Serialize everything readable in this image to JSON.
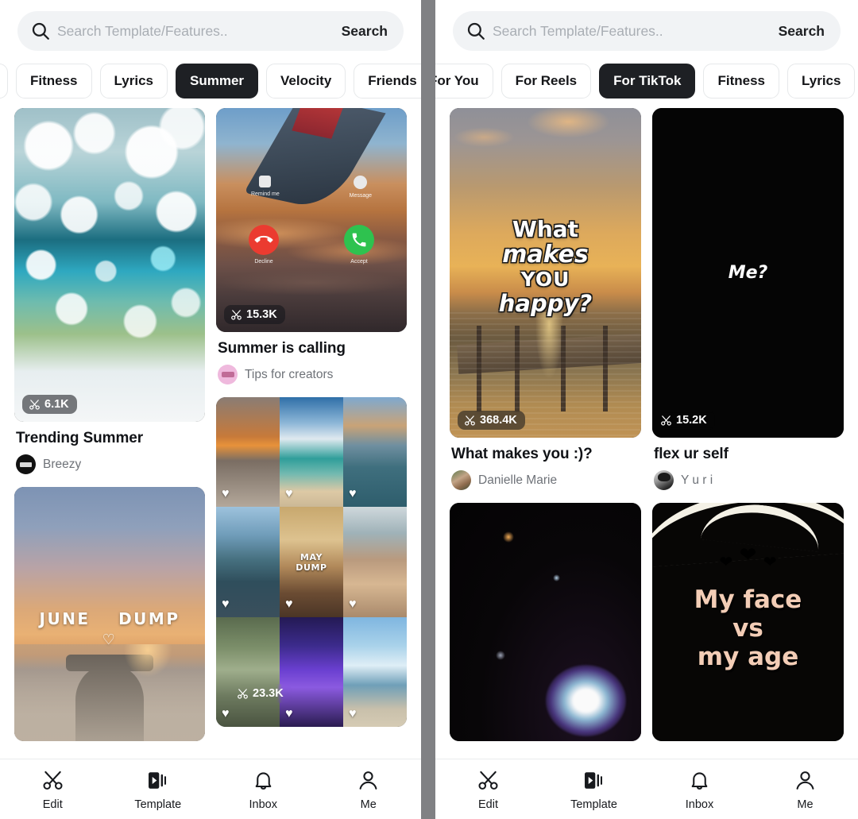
{
  "panels": [
    {
      "id": "left",
      "search": {
        "placeholder": "Search Template/Features..",
        "value": "",
        "button_label": "Search"
      },
      "chips": [
        {
          "label": "",
          "active": false,
          "clipped": true
        },
        {
          "label": "Fitness",
          "active": false
        },
        {
          "label": "Lyrics",
          "active": false
        },
        {
          "label": "Summer",
          "active": true
        },
        {
          "label": "Velocity",
          "active": false
        },
        {
          "label": "Friends",
          "active": false
        }
      ],
      "cards": {
        "col1": [
          {
            "title": "Trending Summer",
            "author": "Breezy",
            "uses": "6.1K",
            "scene": "bokeh",
            "avatar": "av-black"
          },
          {
            "title": "",
            "author": "",
            "uses": "",
            "scene": "beachsunset",
            "overlay": {
              "line1": "JUNE",
              "line2": "DUMP",
              "heart": "♡"
            }
          }
        ],
        "col2": [
          {
            "title": "Summer is calling",
            "author": "Tips for creators",
            "uses": "15.3K",
            "scene": "wingsky",
            "avatar": "av-pink",
            "call_ui": {
              "remind": "Remind me",
              "message": "Message",
              "decline": "Decline",
              "accept": "Accept"
            }
          },
          {
            "title": "",
            "author": "",
            "uses": "23.3K",
            "scene": "collage",
            "collage_label": {
              "line1": "MAY",
              "line2": "DUMP"
            }
          }
        ]
      },
      "tabbar": [
        {
          "label": "Edit",
          "icon": "scissors-icon",
          "active": false
        },
        {
          "label": "Template",
          "icon": "template-video-icon",
          "active": true
        },
        {
          "label": "Inbox",
          "icon": "bell-icon",
          "active": false
        },
        {
          "label": "Me",
          "icon": "person-icon",
          "active": false
        }
      ]
    },
    {
      "id": "right",
      "search": {
        "placeholder": "Search Template/Features..",
        "value": "",
        "button_label": "Search"
      },
      "chips": [
        {
          "label": "For You",
          "active": false,
          "clipped": true
        },
        {
          "label": "For Reels",
          "active": false
        },
        {
          "label": "For TikTok",
          "active": true
        },
        {
          "label": "Fitness",
          "active": false
        },
        {
          "label": "Lyrics",
          "active": false
        }
      ],
      "cards": {
        "col1": [
          {
            "title": "What makes you :)?",
            "author": "Danielle Marie",
            "uses": "368.4K",
            "scene": "piersunset",
            "avatar": "av-photo",
            "overlay": {
              "r1": "What",
              "r2": "makes",
              "r3": "YOU",
              "r4": "happy?"
            }
          },
          {
            "title": "",
            "author": "",
            "uses": "",
            "scene": "darkroom"
          }
        ],
        "col2": [
          {
            "title": "flex ur self",
            "author": "Y u r i",
            "uses": "15.2K",
            "scene": "blackscene",
            "avatar": "av-dark",
            "overlay": {
              "text": "Me?"
            }
          },
          {
            "title": "",
            "author": "",
            "uses": "",
            "scene": "facevsage",
            "overlay": {
              "l1": "My face",
              "l2": "vs",
              "l3": "my age"
            }
          }
        ]
      },
      "tabbar": [
        {
          "label": "Edit",
          "icon": "scissors-icon",
          "active": false
        },
        {
          "label": "Template",
          "icon": "template-video-icon",
          "active": true
        },
        {
          "label": "Inbox",
          "icon": "bell-icon",
          "active": false
        },
        {
          "label": "Me",
          "icon": "person-icon",
          "active": false
        }
      ]
    }
  ],
  "colors": {
    "search_bg": "#f1f3f5",
    "chip_active_bg": "#1e2024",
    "text_primary": "#111317",
    "text_secondary": "#6e7278",
    "divider": "#808184",
    "badge_bg": "rgba(20,22,26,.56)",
    "decline_red": "#eb3b30",
    "accept_green": "#2ec24f"
  }
}
